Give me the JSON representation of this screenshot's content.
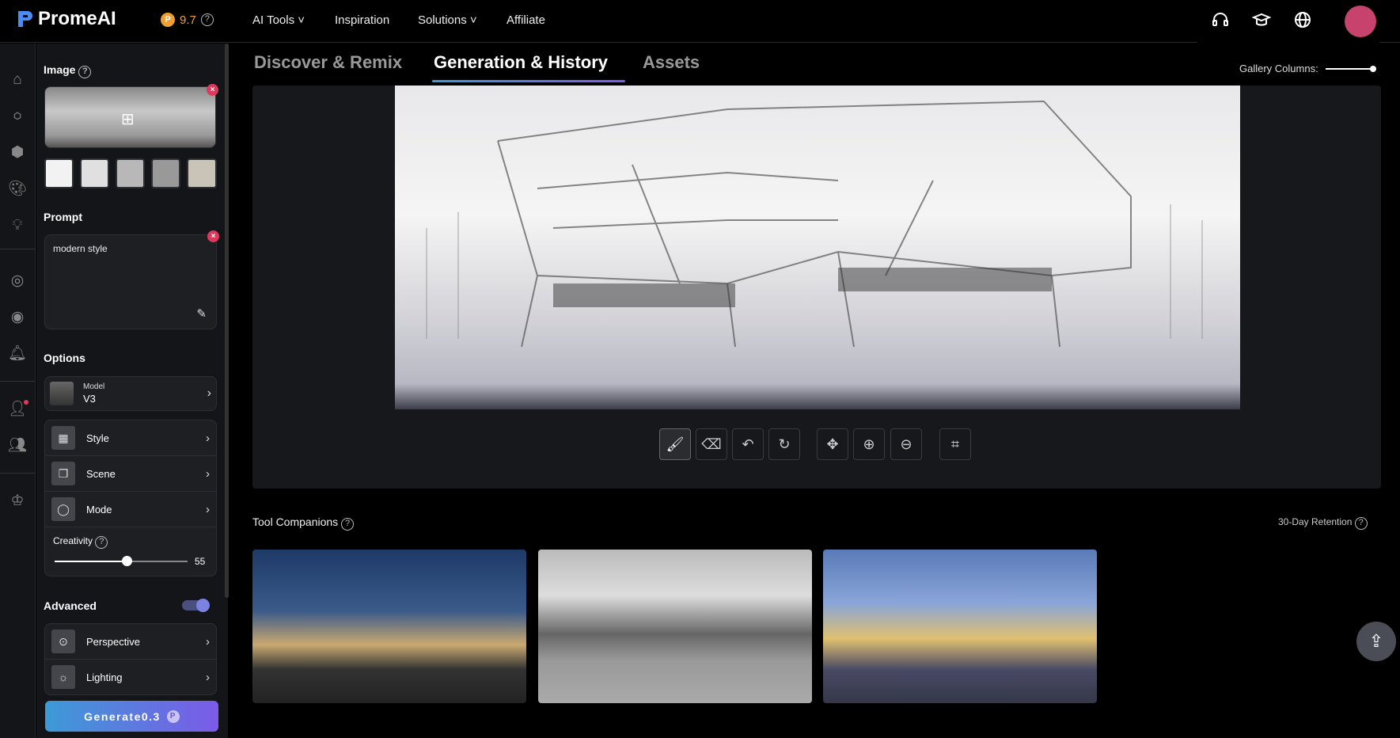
{
  "header": {
    "brand": "PromeAI",
    "credits": "9.7",
    "nav": [
      "AI Tools",
      "Inspiration",
      "Solutions",
      "Affiliate"
    ],
    "icons": [
      "headset-icon",
      "graduation-cap-icon",
      "globe-icon"
    ]
  },
  "rail": {
    "icons": [
      "home-icon",
      "ai-icon",
      "cube-icon",
      "palette-icon",
      "lightbulb-icon",
      "compass-icon",
      "target-icon",
      "bell-icon",
      "user-icon",
      "user-add-icon",
      "crown-icon"
    ]
  },
  "panel": {
    "image_label": "Image",
    "prompt_label": "Prompt",
    "prompt_value": "modern style",
    "options_label": "Options",
    "model": {
      "label": "Model",
      "value": "V3"
    },
    "options": [
      "Style",
      "Scene",
      "Mode"
    ],
    "creativity": {
      "label": "Creativity",
      "value": 55
    },
    "advanced_label": "Advanced",
    "advanced_enabled": true,
    "advanced": [
      "Perspective",
      "Lighting"
    ],
    "generate": {
      "label": "Generate",
      "cost": "0.3"
    }
  },
  "tabs": [
    "Discover & Remix",
    "Generation & History",
    "Assets"
  ],
  "active_tab": 1,
  "gallery_columns_label": "Gallery Columns:",
  "toolbar": [
    "brush-icon",
    "eraser-icon",
    "undo-icon",
    "redo-icon",
    "move-icon",
    "zoom-in-icon",
    "zoom-out-icon",
    "crop-icon"
  ],
  "companions": {
    "title": "Tool Companions",
    "retention": "30-Day Retention"
  },
  "colors": {
    "accent_start": "#3d9ad6",
    "accent_end": "#7b5be8",
    "close": "#e0385a",
    "avatar": "#c8426e"
  }
}
